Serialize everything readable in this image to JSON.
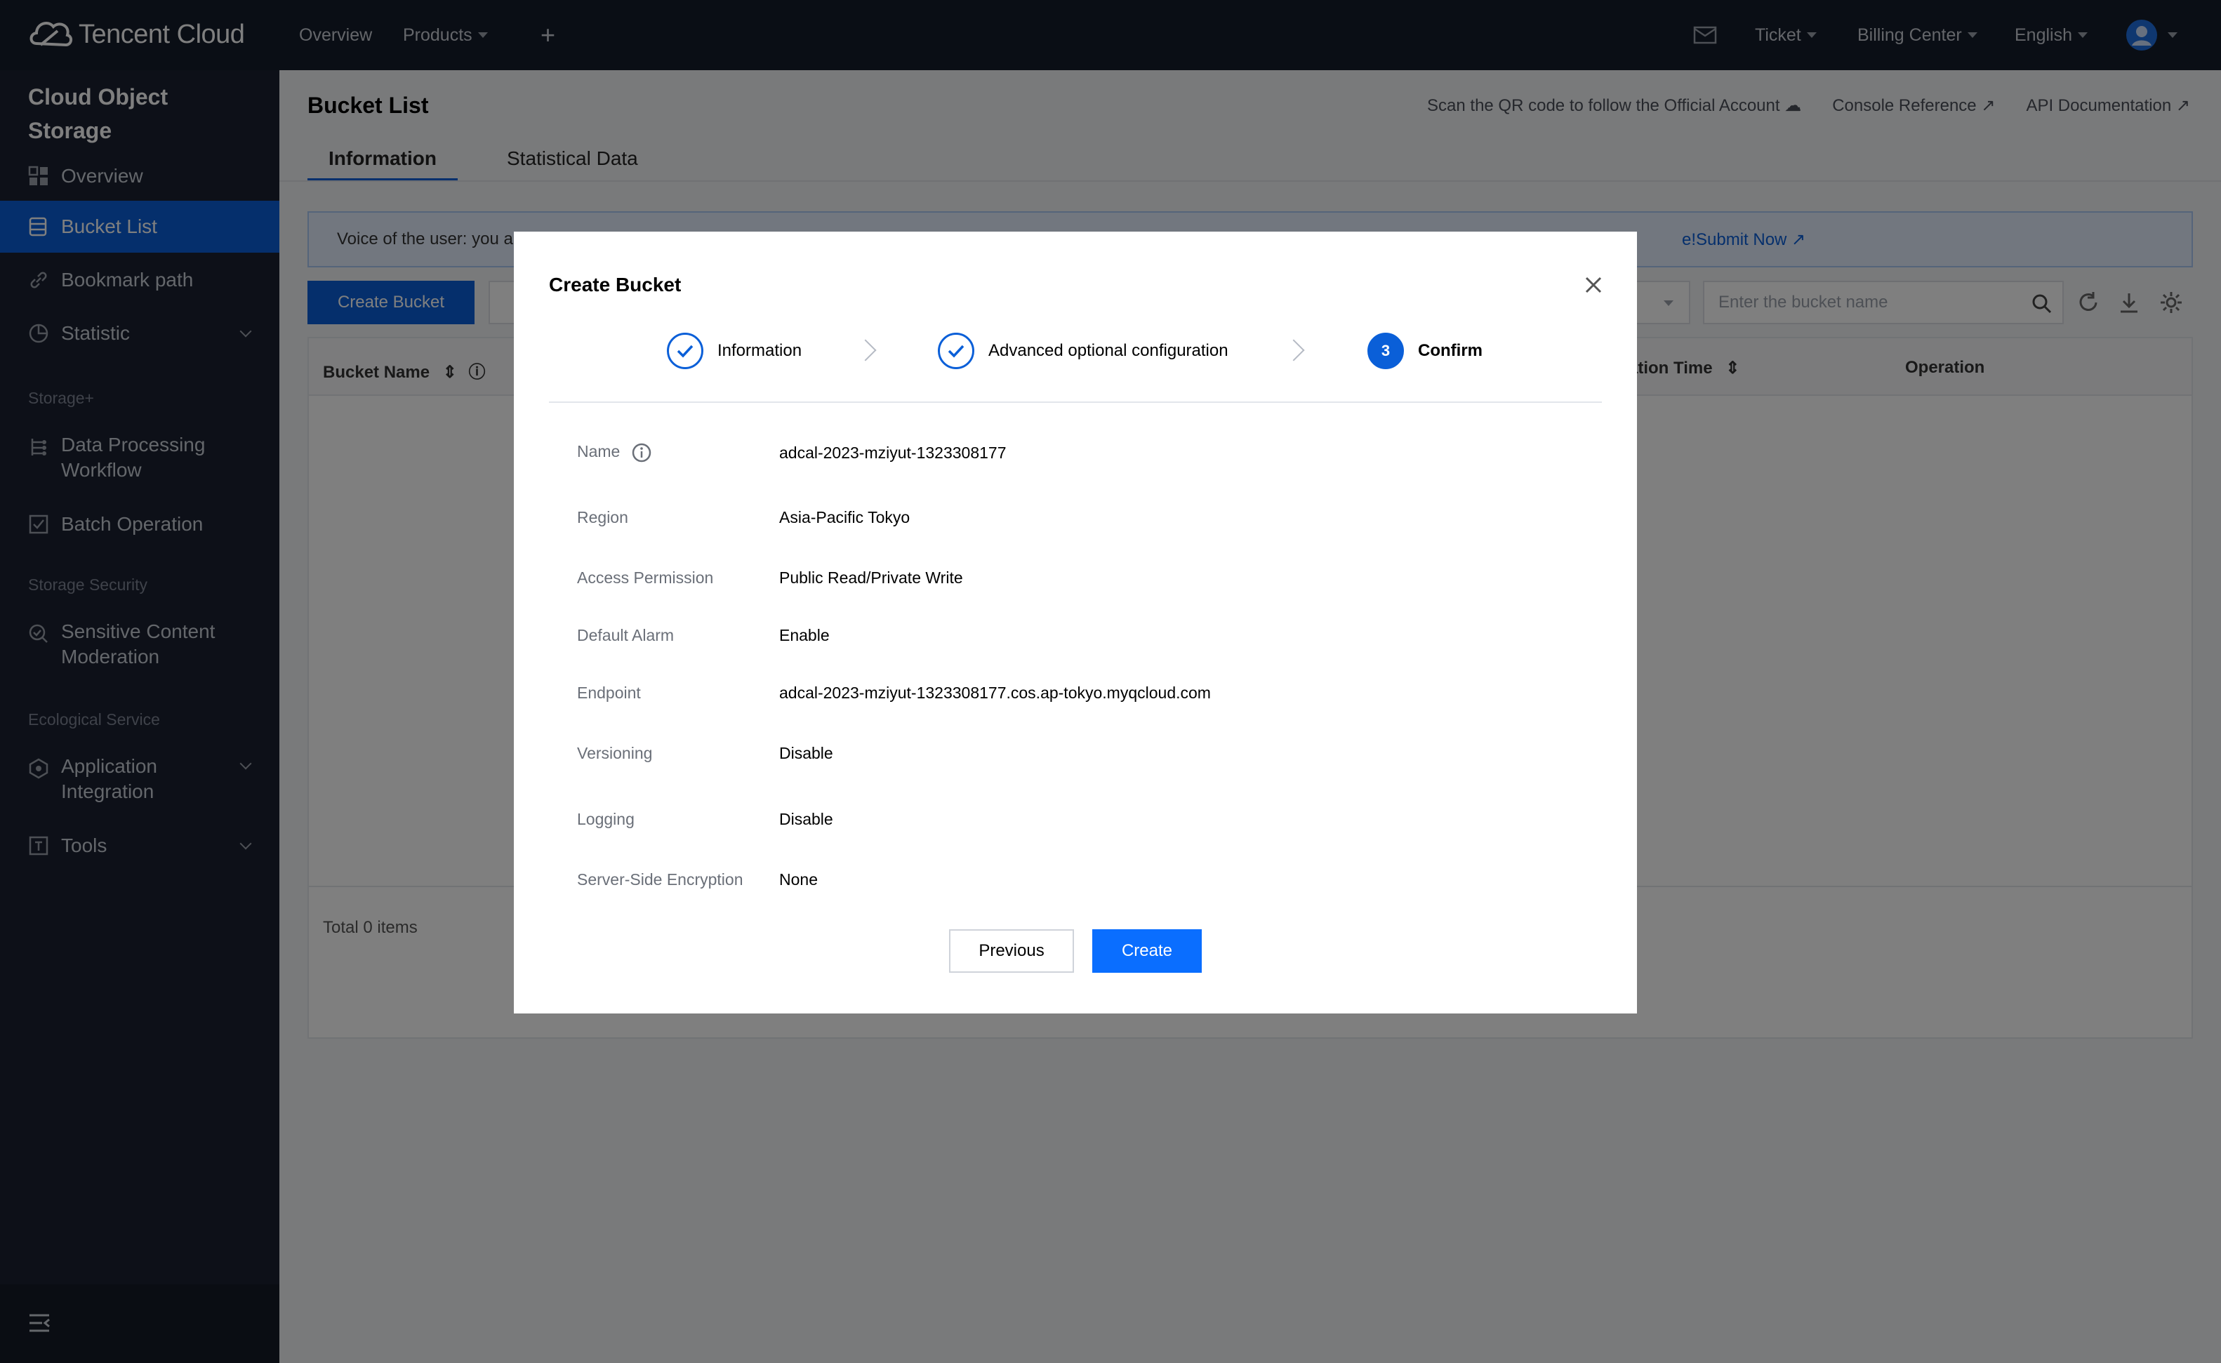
{
  "topbar": {
    "brand": "Tencent Cloud",
    "nav_overview": "Overview",
    "nav_products": "Products",
    "ticket": "Ticket",
    "billing": "Billing Center",
    "language": "English"
  },
  "sidebar": {
    "title_line1": "Cloud Object",
    "title_line2": "Storage",
    "items": [
      {
        "label": "Overview",
        "icon": "grid-icon"
      },
      {
        "label": "Bucket List",
        "icon": "bucket-icon"
      },
      {
        "label": "Bookmark path",
        "icon": "link-icon"
      },
      {
        "label": "Statistic",
        "icon": "pie-chart-icon"
      }
    ],
    "section_storage_plus": "Storage+",
    "workflow_line1": "Data Processing",
    "workflow_line2": "Workflow",
    "batch": "Batch Operation",
    "section_security": "Storage Security",
    "moderation_line1": "Sensitive Content",
    "moderation_line2": "Moderation",
    "section_ecological": "Ecological Service",
    "integration_line1": "Application",
    "integration_line2": "Integration",
    "tools": "Tools"
  },
  "main": {
    "page_title": "Bucket List",
    "links": {
      "qr": "Scan the QR code to follow the Official Account",
      "console_ref": "Console Reference",
      "api_doc": "API Documentation"
    },
    "tabs": [
      {
        "label": "Information",
        "active": true
      },
      {
        "label": "Statistical Data",
        "active": false
      }
    ],
    "notice_text": "Voice of the user: you a",
    "notice_link": "e!Submit Now",
    "create_bucket": "Create Bucket",
    "search_placeholder": "Enter the bucket name",
    "columns": {
      "bucket_name": "Bucket Name",
      "creation_time": "ation Time",
      "operation": "Operation"
    },
    "total": "Total 0 items"
  },
  "modal": {
    "title": "Create Bucket",
    "steps": [
      {
        "label": "Information",
        "state": "done"
      },
      {
        "label": "Advanced optional configuration",
        "state": "done"
      },
      {
        "label": "Confirm",
        "state": "current",
        "number": "3"
      }
    ],
    "fields": [
      {
        "label": "Name",
        "value": "adcal-2023-mziyut-1323308177"
      },
      {
        "label": "Region",
        "value": "Asia-Pacific Tokyo"
      },
      {
        "label": "Access Permission",
        "value": "Public Read/Private Write"
      },
      {
        "label": "Default Alarm",
        "value": "Enable"
      },
      {
        "label": "Endpoint",
        "value": "adcal-2023-mziyut-1323308177.cos.ap-tokyo.myqcloud.com"
      },
      {
        "label": "Versioning",
        "value": "Disable"
      },
      {
        "label": "Logging",
        "value": "Disable"
      },
      {
        "label": "Server-Side Encryption",
        "value": "None"
      }
    ],
    "previous": "Previous",
    "create": "Create"
  },
  "colors": {
    "accent": "#0a5fd8",
    "topbar_bg": "#151d2b",
    "sidebar_bg": "#1a2131"
  }
}
